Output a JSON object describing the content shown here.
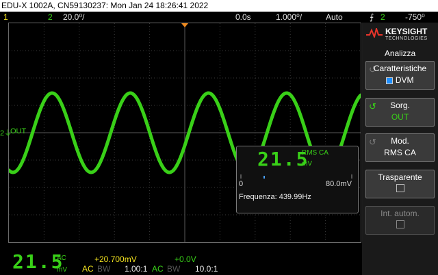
{
  "titlebar": {
    "text": "EDU-X 1002A, CN59130237: Mon Jan 24 18:26:41 2022"
  },
  "status": {
    "ch1": "1",
    "ch2": "2",
    "ch2_scale": "20.0⁰/",
    "delay": "0.0s",
    "timebase": "1.000⁰/",
    "trigger_mode": "Auto",
    "trigger_icon": "⨍",
    "trigger_source": "2",
    "trigger_level": "-750⁰"
  },
  "colors": {
    "ch1": "#f2e21f",
    "ch2": "#39d018",
    "trigger_marker": "#f08a1e"
  },
  "grid": {
    "channel_marker": "2⏚",
    "channel_label": "OUT"
  },
  "panel": {
    "brand_name": "KEYSIGHT",
    "brand_sub": "TECHNOLOGIES",
    "title": "Analizza",
    "buttons": [
      {
        "label": "Caratteristiche",
        "value": "DVM"
      },
      {
        "label": "Sorg.",
        "value": "OUT"
      },
      {
        "label": "Mod.",
        "value": "RMS CA"
      },
      {
        "label": "Trasparente",
        "value": ""
      },
      {
        "label": "Int. autom.",
        "value": ""
      }
    ]
  },
  "measurement": {
    "value": "21.5",
    "mode": "RMS CA",
    "unit": "mV",
    "scale_min": "0",
    "scale_max": "80.0mV",
    "frequency": "Frequenza: 439.99Hz"
  },
  "bottom": {
    "dvm_value": "21.5",
    "dvm_mode": "AC",
    "dvm_unit": "mV",
    "ch1_offset": "+20.700mV",
    "ch1_coupling": "AC",
    "ch1_bw": "BW",
    "ch1_probe": "1.00:1",
    "ch2_offset": "+0.0V",
    "ch2_coupling": "AC",
    "ch2_bw": "BW",
    "ch2_probe": "10.0:1"
  }
}
